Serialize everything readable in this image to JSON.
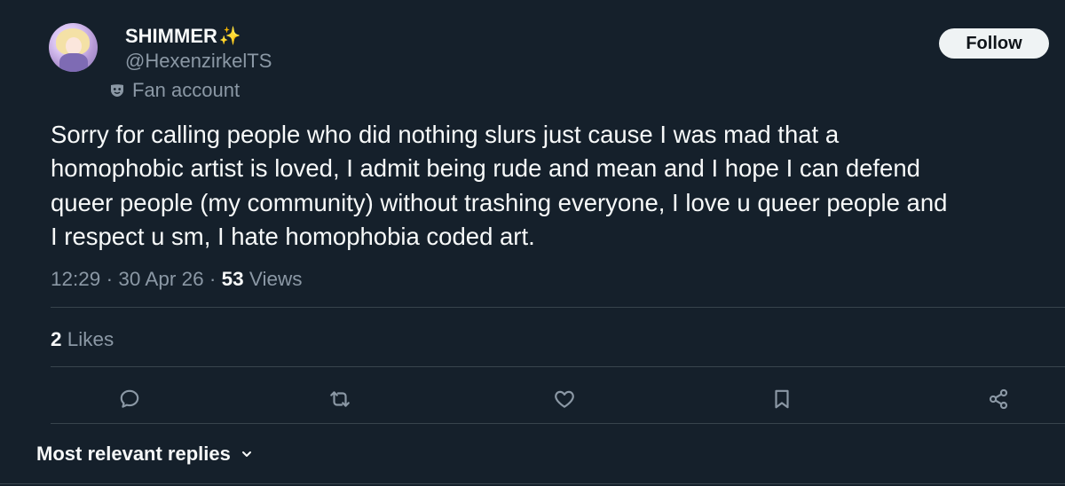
{
  "author": {
    "display_name": "SHIMMER",
    "emoji": "✨",
    "handle": "@HexenzirkelTS",
    "label": "Fan account",
    "label_icon": "mask-icon"
  },
  "follow_label": "Follow",
  "tweet": {
    "lines": [
      "Sorry for calling people who did nothing slurs just cause I was mad that a",
      "homophobic artist is loved, I admit being rude and mean and I hope I can defend",
      "queer people (my community) without trashing everyone, I love u queer people and",
      "I respect u sm, I hate homophobia coded art."
    ]
  },
  "meta": {
    "time": "12:29",
    "sep1": " · ",
    "date": "30 Apr 26",
    "sep2": " · ",
    "views_count": "53",
    "views_label": " Views"
  },
  "likes": {
    "count": "2",
    "label": " Likes"
  },
  "actions": [
    "reply-icon",
    "retweet-icon",
    "like-icon",
    "bookmark-icon",
    "share-icon"
  ],
  "replies_sort": "Most relevant replies",
  "colors": {
    "background": "#15202b",
    "text": "#f7f9f9",
    "muted": "#8b98a5",
    "divider": "#38444d",
    "button_bg": "#eff3f4"
  }
}
